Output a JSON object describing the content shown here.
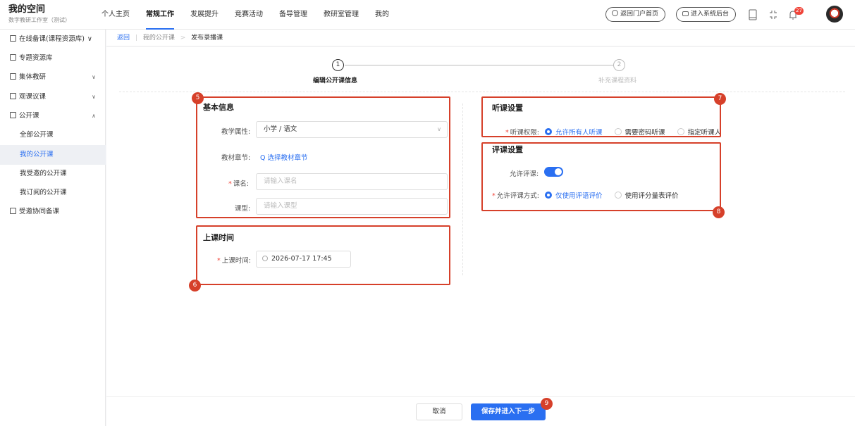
{
  "brand": {
    "title": "我的空间",
    "subtitle": "数字教研工作室（测试）"
  },
  "nav": [
    "个人主页",
    "常规工作",
    "发展提升",
    "竞赛活动",
    "备导管理",
    "教研室管理",
    "我的"
  ],
  "nav_active": "常规工作",
  "top_actions": {
    "portal": "返回门户首页",
    "backend": "进入系统后台",
    "notice_count": "27"
  },
  "sidebar": {
    "items": [
      {
        "label": "在线备课(课程资源库)",
        "chev": "∨"
      },
      {
        "label": "专题资源库",
        "chev": ""
      },
      {
        "label": "集体教研",
        "chev": "∨"
      },
      {
        "label": "观课议课",
        "chev": "∨"
      },
      {
        "label": "公开课",
        "chev": "∧"
      },
      {
        "label": "全部公开课"
      },
      {
        "label": "我的公开课"
      },
      {
        "label": "我受邀的公开课"
      },
      {
        "label": "我订阅的公开课"
      },
      {
        "label": "受邀协同备课",
        "chev": ""
      }
    ]
  },
  "breadcrumb": {
    "back": "返回",
    "parent": "我的公开课",
    "current": "发布录播课"
  },
  "steps": [
    {
      "num": "1",
      "label": "编辑公开课信息"
    },
    {
      "num": "2",
      "label": "补充课程资料"
    }
  ],
  "basic": {
    "title": "基本信息",
    "attr_label": "教学属性:",
    "attr_value": "小学 / 语文",
    "chapter_label": "教材章节:",
    "chapter_link": "选择教材章节",
    "name_label": "课名:",
    "name_placeholder": "请输入课名",
    "type_label": "课型:",
    "type_placeholder": "请输入课型"
  },
  "time": {
    "title": "上课时间",
    "label": "上课时间:",
    "value": "2026-07-17 17:45"
  },
  "listen": {
    "title": "听课设置",
    "label": "听课权限:",
    "options": [
      "允许所有人听课",
      "需要密码听课",
      "指定听课人"
    ]
  },
  "review": {
    "title": "评课设置",
    "allow_label": "允许评课:",
    "allow_on": true,
    "mode_label": "允许评课方式:",
    "options": [
      "仅使用评语评价",
      "使用评分量表评价"
    ]
  },
  "markers": [
    "5",
    "6",
    "7",
    "8",
    "9"
  ],
  "footer": {
    "cancel": "取消",
    "save": "保存并进入下一步"
  },
  "colors": {
    "accent": "#2a6ff1",
    "annotation": "#d6402a"
  }
}
